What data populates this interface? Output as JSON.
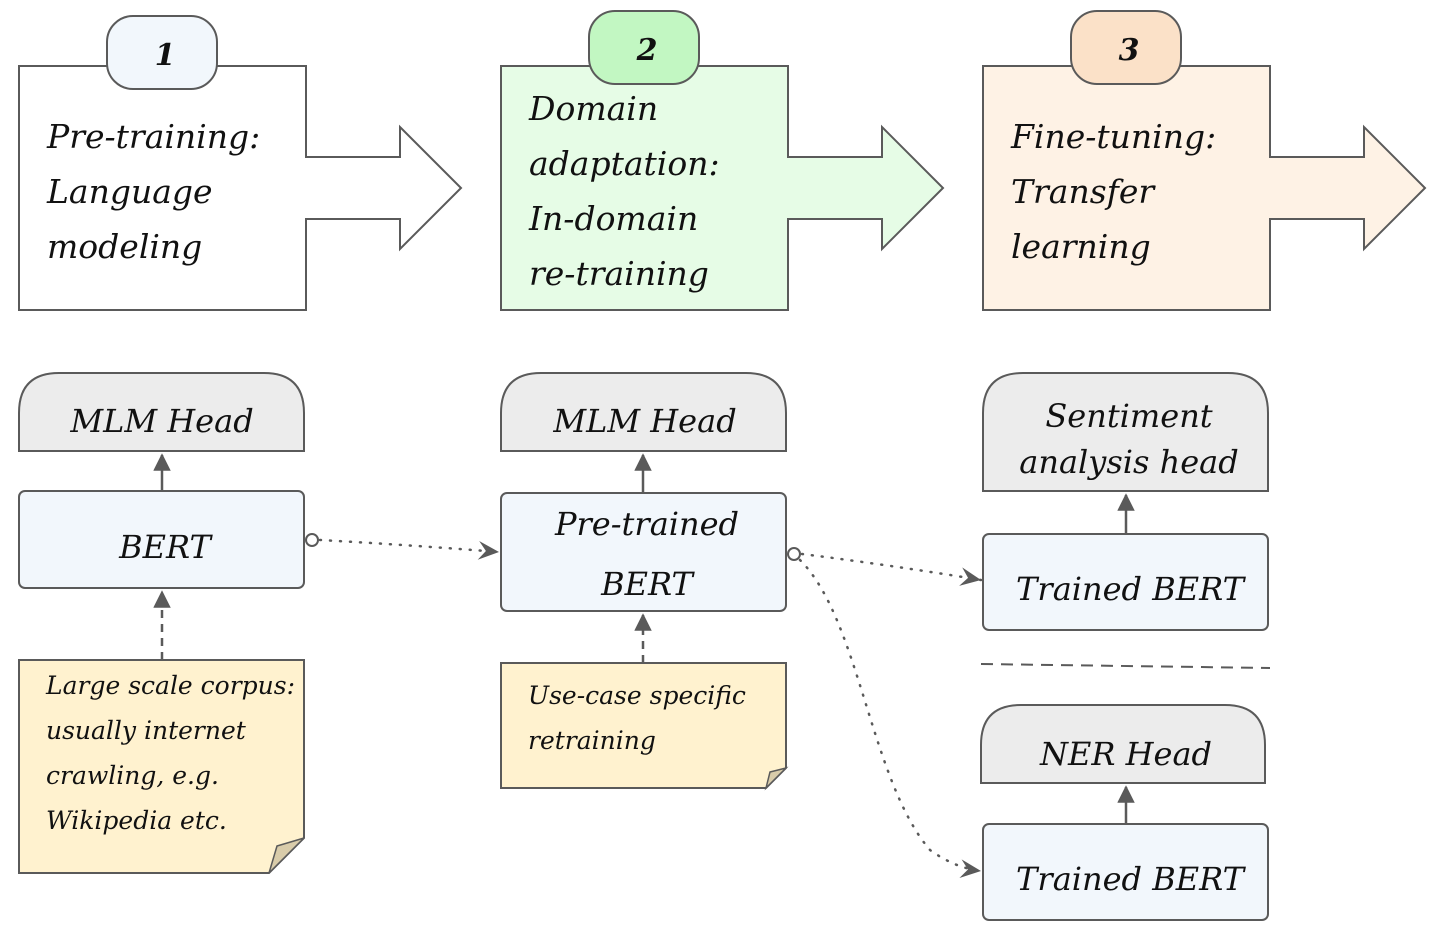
{
  "stages": [
    {
      "number": "1",
      "lines": [
        "Pre-training:",
        "Language",
        "modeling"
      ],
      "fill": "#ffffff",
      "badge_fill": "#f2f7fc"
    },
    {
      "number": "2",
      "lines": [
        "Domain",
        "adaptation:",
        "In-domain",
        "re-training"
      ],
      "fill": "#e6fce6",
      "badge_fill": "#c2f7c2"
    },
    {
      "number": "3",
      "lines": [
        "Fine-tuning:",
        "Transfer",
        "learning"
      ],
      "fill": "#fef2e5",
      "badge_fill": "#fbe1c8"
    }
  ],
  "columns": {
    "pretraining": {
      "head": "MLM Head",
      "model": [
        "BERT"
      ],
      "note": [
        "Large scale corpus:",
        "usually internet",
        "crawling, e.g.",
        "Wikipedia etc."
      ]
    },
    "domain": {
      "head": "MLM Head",
      "model": [
        "Pre-trained",
        "BERT"
      ],
      "note": [
        "Use-case specific",
        "retraining"
      ]
    },
    "finetune": {
      "sentiment_head": [
        "Sentiment",
        "analysis head"
      ],
      "sentiment_model": [
        "Trained BERT"
      ],
      "ner_head": [
        "NER Head"
      ],
      "ner_model": [
        "Trained BERT"
      ]
    }
  },
  "colors": {
    "stroke": "#5a5a5a",
    "head_fill": "#ececec",
    "model_fill": "#f2f7fc",
    "note_fill": "#fff2cf",
    "note_fold": "#d9ccaa"
  }
}
